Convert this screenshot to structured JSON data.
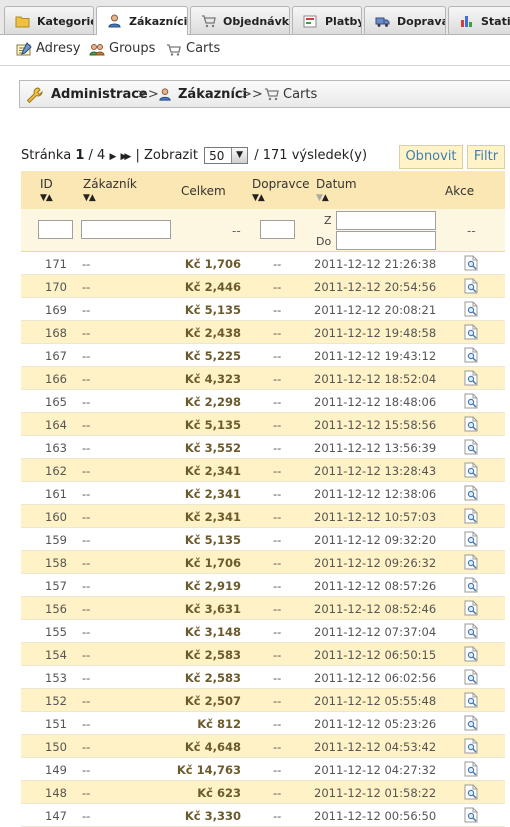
{
  "tabs": [
    {
      "label": "Kategorie",
      "icon": "folder-icon",
      "active": false
    },
    {
      "label": "Zákazníci",
      "icon": "user-icon",
      "active": true
    },
    {
      "label": "Objednávky",
      "icon": "cart-icon",
      "active": false
    },
    {
      "label": "Platby",
      "icon": "payment-icon",
      "active": false
    },
    {
      "label": "Doprava",
      "icon": "truck-icon",
      "active": false
    },
    {
      "label": "Statistiky",
      "icon": "chart-icon",
      "active": false
    }
  ],
  "submenu": [
    {
      "label": "Adresy",
      "icon": "address-icon"
    },
    {
      "label": "Groups",
      "icon": "group-icon"
    },
    {
      "label": "Carts",
      "icon": "cart-icon"
    }
  ],
  "breadcrumb": {
    "root": "Administrace",
    "sep": ">>",
    "section": "Zákazníci",
    "current": "Carts"
  },
  "pager": {
    "page_label": "Stránka",
    "page": "1",
    "total_pages": "/ 4",
    "show_label": "| Zobrazit",
    "per_page": "50",
    "results": "/ 171 výsledek(y)",
    "refresh_label": "Obnovit",
    "filter_label": "Filtr"
  },
  "columns": {
    "id": "ID",
    "customer": "Zákazník",
    "total": "Celkem",
    "carrier": "Dopravce",
    "date": "Datum",
    "actions": "Akce"
  },
  "filters": {
    "total_placeholder": "--",
    "date_from_label": "Z",
    "date_to_label": "Do",
    "actions_placeholder": "--"
  },
  "rows": [
    {
      "id": "171",
      "customer": "--",
      "total": "Kč 1,706",
      "carrier": "--",
      "date": "2011-12-12 21:26:38"
    },
    {
      "id": "170",
      "customer": "--",
      "total": "Kč 2,446",
      "carrier": "--",
      "date": "2011-12-12 20:54:56"
    },
    {
      "id": "169",
      "customer": "--",
      "total": "Kč 5,135",
      "carrier": "--",
      "date": "2011-12-12 20:08:21"
    },
    {
      "id": "168",
      "customer": "--",
      "total": "Kč 2,438",
      "carrier": "--",
      "date": "2011-12-12 19:48:58"
    },
    {
      "id": "167",
      "customer": "--",
      "total": "Kč 5,225",
      "carrier": "--",
      "date": "2011-12-12 19:43:12"
    },
    {
      "id": "166",
      "customer": "--",
      "total": "Kč 4,323",
      "carrier": "--",
      "date": "2011-12-12 18:52:04"
    },
    {
      "id": "165",
      "customer": "--",
      "total": "Kč 2,298",
      "carrier": "--",
      "date": "2011-12-12 18:48:06"
    },
    {
      "id": "164",
      "customer": "--",
      "total": "Kč 5,135",
      "carrier": "--",
      "date": "2011-12-12 15:58:56"
    },
    {
      "id": "163",
      "customer": "--",
      "total": "Kč 3,552",
      "carrier": "--",
      "date": "2011-12-12 13:56:39"
    },
    {
      "id": "162",
      "customer": "--",
      "total": "Kč 2,341",
      "carrier": "--",
      "date": "2011-12-12 13:28:43"
    },
    {
      "id": "161",
      "customer": "--",
      "total": "Kč 2,341",
      "carrier": "--",
      "date": "2011-12-12 12:38:06"
    },
    {
      "id": "160",
      "customer": "--",
      "total": "Kč 2,341",
      "carrier": "--",
      "date": "2011-12-12 10:57:03"
    },
    {
      "id": "159",
      "customer": "--",
      "total": "Kč 5,135",
      "carrier": "--",
      "date": "2011-12-12 09:32:20"
    },
    {
      "id": "158",
      "customer": "--",
      "total": "Kč 1,706",
      "carrier": "--",
      "date": "2011-12-12 09:26:32"
    },
    {
      "id": "157",
      "customer": "--",
      "total": "Kč 2,919",
      "carrier": "--",
      "date": "2011-12-12 08:57:26"
    },
    {
      "id": "156",
      "customer": "--",
      "total": "Kč 3,631",
      "carrier": "--",
      "date": "2011-12-12 08:52:46"
    },
    {
      "id": "155",
      "customer": "--",
      "total": "Kč 3,148",
      "carrier": "--",
      "date": "2011-12-12 07:37:04"
    },
    {
      "id": "154",
      "customer": "--",
      "total": "Kč 2,583",
      "carrier": "--",
      "date": "2011-12-12 06:50:15"
    },
    {
      "id": "153",
      "customer": "--",
      "total": "Kč 2,583",
      "carrier": "--",
      "date": "2011-12-12 06:02:56"
    },
    {
      "id": "152",
      "customer": "--",
      "total": "Kč 2,507",
      "carrier": "--",
      "date": "2011-12-12 05:55:48"
    },
    {
      "id": "151",
      "customer": "--",
      "total": "Kč 812",
      "carrier": "--",
      "date": "2011-12-12 05:23:26"
    },
    {
      "id": "150",
      "customer": "--",
      "total": "Kč 4,648",
      "carrier": "--",
      "date": "2011-12-12 04:53:42"
    },
    {
      "id": "149",
      "customer": "--",
      "total": "Kč 14,763",
      "carrier": "--",
      "date": "2011-12-12 04:27:32"
    },
    {
      "id": "148",
      "customer": "--",
      "total": "Kč 623",
      "carrier": "--",
      "date": "2011-12-12 01:58:22"
    },
    {
      "id": "147",
      "customer": "--",
      "total": "Kč 3,330",
      "carrier": "--",
      "date": "2011-12-12 00:56:50"
    }
  ],
  "colors": {
    "header_bg": "#fbe7b3",
    "row_alt_bg": "#fff2c6",
    "link_blue": "#3d7fb5"
  }
}
